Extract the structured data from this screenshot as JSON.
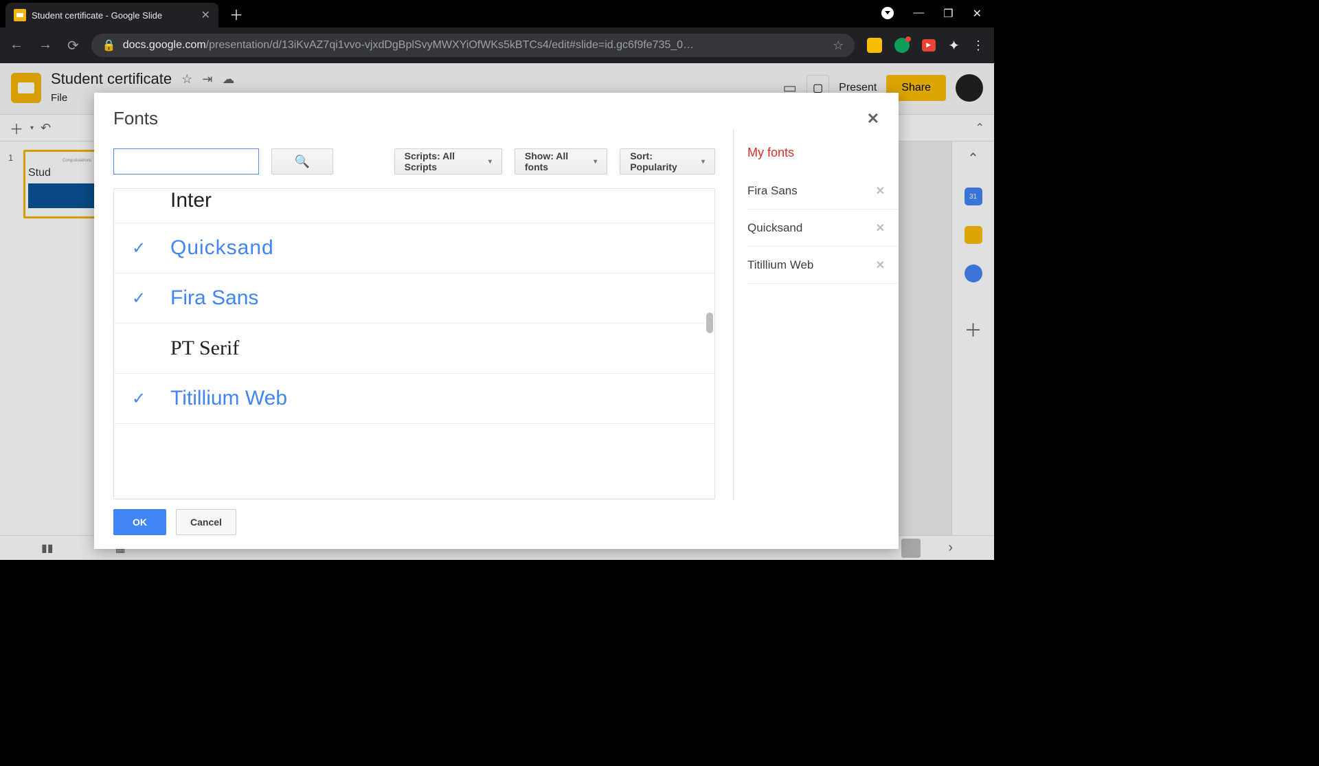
{
  "browser": {
    "tab_title": "Student certificate - Google Slide",
    "url_domain": "docs.google.com",
    "url_path": "/presentation/d/13iKvAZ7qi1vvo-vjxdDgBplSvyMWXYiOfWKs5kBTCs4/edit#slide=id.gc6f9fe735_0…"
  },
  "app": {
    "doc_title": "Student certificate",
    "menu_file": "File",
    "present": "Present",
    "share": "Share",
    "slide_number": "1",
    "thumb_line1": "Congratulations",
    "thumb_line2": "Stud"
  },
  "sidepanel": {
    "cal": "31"
  },
  "modal": {
    "title": "Fonts",
    "search_placeholder": "",
    "scripts_label": "Scripts: All Scripts",
    "show_label": "Show: All fonts",
    "sort_label": "Sort: Popularity",
    "myfonts_title": "My fonts",
    "ok": "OK",
    "cancel": "Cancel",
    "fonts": [
      {
        "name": "Inter",
        "selected": false,
        "cls": "inter"
      },
      {
        "name": "Quicksand",
        "selected": true,
        "cls": "quicksand"
      },
      {
        "name": "Fira Sans",
        "selected": true,
        "cls": "firasans"
      },
      {
        "name": "PT Serif",
        "selected": false,
        "cls": "ptserif"
      },
      {
        "name": "Titillium Web",
        "selected": true,
        "cls": "titillium"
      }
    ],
    "myfonts": [
      {
        "name": "Fira Sans"
      },
      {
        "name": "Quicksand"
      },
      {
        "name": "Titillium Web"
      }
    ]
  }
}
